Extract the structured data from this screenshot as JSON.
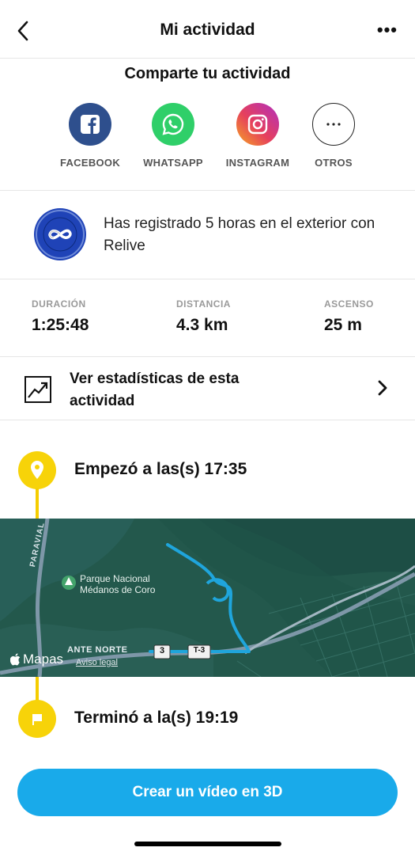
{
  "header": {
    "title": "Mi actividad",
    "more_label": "•••"
  },
  "share": {
    "title": "Comparte tu actividad",
    "items": [
      {
        "label": "FACEBOOK",
        "icon": "facebook-icon",
        "color": "#2e4f8d"
      },
      {
        "label": "WHATSAPP",
        "icon": "whatsapp-icon",
        "color": "#2fcf69"
      },
      {
        "label": "INSTAGRAM",
        "icon": "instagram-icon",
        "color": "#d6307f"
      },
      {
        "label": "OTROS",
        "icon": "more-dots-icon",
        "color": "#ffffff"
      }
    ]
  },
  "relive": {
    "text": "Has registrado 5 horas en el exterior con Relive",
    "badge_color": "#1f43b7"
  },
  "stats": [
    {
      "key": "DURACIÓN",
      "value": "1:25:48"
    },
    {
      "key": "DISTANCIA",
      "value": "4.3 km"
    },
    {
      "key": "ASCENSO",
      "value": "25 m"
    }
  ],
  "view_stats": {
    "label": "Ver estadísticas de esta actividad"
  },
  "start": {
    "label": "Empezó a las(s) 17:35"
  },
  "map": {
    "park_label_1": "Parque Nacional",
    "park_label_2": "Médanos de Coro",
    "road_label_paraviale": "PARAVIAL",
    "road_label_norte": "ANTE NORTE",
    "road_badge_3": "3",
    "road_badge_t3": "T-3",
    "attribution": "Mapas",
    "legal": "Aviso legal",
    "route_color": "#1fa5dc",
    "background_color": "#23584c"
  },
  "end": {
    "label": "Terminó a la(s) 19:19"
  },
  "cta": {
    "label": "Crear un vídeo en 3D",
    "color": "#19aaea"
  },
  "accent": "#f7d309"
}
